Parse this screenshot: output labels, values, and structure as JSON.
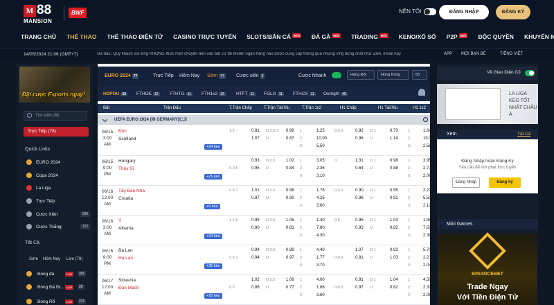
{
  "header": {
    "logo_icon": "M",
    "logo_num": "88",
    "logo_text": "MANSION",
    "partner": "BWF",
    "dark_mode": "NỀN TỐI",
    "login": "ĐĂNG NHẬP",
    "register": "ĐĂNG KÝ"
  },
  "nav": [
    {
      "label": "TRANG CHỦ"
    },
    {
      "label": "THỂ THAO",
      "active": true
    },
    {
      "label": "THỂ THAO ĐIỆN TỬ"
    },
    {
      "label": "CASINO TRỰC TUYẾN"
    },
    {
      "label": "SLOTS/BẮN CÁ",
      "hot": "MỚI"
    },
    {
      "label": "ĐÁ GÀ",
      "hot": "MỚI"
    },
    {
      "label": "TRADING",
      "hot": "MỚI"
    },
    {
      "label": "KENO/XỔ SỐ"
    },
    {
      "label": "P2P",
      "hot": "MỚI"
    },
    {
      "label": "ĐỘC QUYỀN"
    },
    {
      "label": "KHUYẾN MÃI"
    },
    {
      "label": "VIP"
    }
  ],
  "ticker": {
    "datetime": "14/05/2024 21:06 (GMT+7)",
    "message": "Ga đấu: Quý khách vui lòng KHÔNG thực hiện chuyển tiền vào bất cứ tài khoản ngân hàng nào được cung cấp thông qua những ứng dụng chat như Zalo, email hay",
    "app": "APP",
    "refer": "MỜI BẠN BÈ",
    "lang": "TIẾNG VIỆT"
  },
  "left": {
    "banner": "Đặt cược Esports ngay!",
    "search": "Tìm kiếm đội",
    "live": "Trực Tiếp (78)",
    "quick_links": "Quick Links",
    "links": [
      {
        "label": "EURO 2024",
        "icon": "trophy-icon"
      },
      {
        "label": "Copa 2024",
        "icon": "trophy-icon"
      },
      {
        "label": "La Liga",
        "icon": "ball-icon"
      },
      {
        "label": "Trực Tiếp",
        "icon": "live-icon"
      },
      {
        "label": "Cược Xiên",
        "count": "583",
        "icon": "parlay-icon"
      },
      {
        "label": "Cược Thắng",
        "count": "152",
        "icon": "win-icon"
      }
    ],
    "all": "Tất Cả",
    "tabs": [
      "Sớm",
      "Hôm Nay",
      "Live (78)"
    ],
    "sports": [
      {
        "label": "Bóng đá",
        "live": "Live",
        "count": "391"
      },
      {
        "label": "Bóng Đá Đi...",
        "live": "Live",
        "count": "29"
      },
      {
        "label": "Bóng Rổ",
        "live": "Live",
        "count": "221"
      }
    ]
  },
  "center": {
    "league_tab": "EURO 2024",
    "league_count": "77",
    "tabs": [
      {
        "label": "Trực Tiếp"
      },
      {
        "label": "Hôm Nay"
      },
      {
        "label": "Sớm",
        "count": "77",
        "active": true
      }
    ],
    "parlay": "Cược xiên",
    "parlay_count": "0",
    "quick": "Cược Nhanh",
    "sort": "Hàng Đội",
    "odds": "Hong Kong",
    "count55": "55",
    "markets": [
      {
        "label": "HDPOU",
        "count": "12",
        "active": true
      },
      {
        "label": "FTHOE",
        "count": "12"
      },
      {
        "label": "FTHTG",
        "count": "11"
      },
      {
        "label": "FTH1x2",
        "count": "12"
      },
      {
        "label": "HTFT",
        "count": "11"
      },
      {
        "label": "FGLG",
        "count": "11"
      },
      {
        "label": "FTHCS",
        "count": "11"
      },
      {
        "label": "Outright",
        "count": "45"
      }
    ],
    "columns": [
      "Bắt",
      "Trận Đấu",
      "T.Trận Chấp",
      "T.Trận Tài/Xỉu",
      "T.Trận 1x2",
      "H1 Chấp",
      "H1 Tài/Xỉu",
      "H1 1x2"
    ],
    "league": "UEFA EURO 2024 (IN GERMANY)",
    "league_matches": "12",
    "matches": [
      {
        "date": "06/15",
        "time": "3:00",
        "ampm": "AM",
        "home": "Đức",
        "away": "Scotland",
        "hl": "home",
        "more": "+24 kèo",
        "hdp": [
          "1.5",
          "",
          "0.81",
          "1.07"
        ],
        "ou": [
          "O 2.5-3",
          "U",
          "0.99",
          "0.87"
        ],
        "x12": [
          "1.25",
          "10.00",
          "5.50"
        ],
        "h1h": [
          "0.5-1",
          "",
          "0.92",
          "0.96"
        ],
        "h1ou": [
          "O 1",
          "U",
          "0.73",
          "1.14"
        ],
        "h1x": [
          "1.64",
          "10.00",
          "2.58"
        ]
      },
      {
        "date": "06/15",
        "time": "9:00",
        "ampm": "PM",
        "home": "Hungary",
        "away": "Thụy Sĩ",
        "hl": "away",
        "more": "+25 kèo",
        "hdp": [
          "",
          "0-0.5",
          "0.93",
          "0.95"
        ],
        "ou": [
          "O 2.5",
          "U",
          "1.02",
          "0.84"
        ],
        "x12": [
          "3.05",
          "2.36",
          "3.10"
        ],
        "h1h": [
          "0",
          "",
          "1.31",
          "0.64"
        ],
        "h1ou": [
          "O 1",
          "U",
          "0.98",
          "0.88"
        ],
        "h1x": [
          "3.95",
          "2.77",
          "2.06"
        ]
      },
      {
        "date": "06/16",
        "time": "12:00",
        "ampm": "AM",
        "home": "Tây Ban Nha",
        "away": "Croatia",
        "hl": "home",
        "more": "+6 kèo",
        "hdp": [
          "0.5-1",
          "",
          "1.01",
          "0.87"
        ],
        "ou": [
          "O 2.5",
          "U",
          "0.96",
          "0.90"
        ],
        "x12": [
          "1.76",
          "4.25",
          "3.60"
        ],
        "h1h": [
          "0-0.5",
          "",
          "0.90",
          "0.98"
        ],
        "h1ou": [
          "O 1",
          "U",
          "0.95",
          "0.91"
        ],
        "h1x": [
          "2.27",
          "5.50",
          "2.12"
        ]
      },
      {
        "date": "06/16",
        "time": "3:00",
        "ampm": "AM",
        "home": "Ý",
        "away": "Albania",
        "hl": "home",
        "more": "+24 kèo",
        "hdp": [
          "1-1.5",
          "",
          "0.98",
          "0.90"
        ],
        "ou": [
          "O 2.5",
          "U",
          "1.05",
          "0.81"
        ],
        "x12": [
          "1.40",
          "7.80",
          "4.30"
        ],
        "h1h": [
          "0.5",
          "",
          "0.95",
          "0.93"
        ],
        "h1ou": [
          "O 1",
          "U",
          "1.04",
          "0.82"
        ],
        "h1x": [
          "1.95",
          "7.50",
          "2.38"
        ]
      },
      {
        "date": "06/16",
        "time": "9:00",
        "ampm": "PM",
        "home": "Ba Lan",
        "away": "Hà Lan",
        "hl": "away",
        "more": "+25 kèo",
        "hdp": [
          "",
          "0.5-1",
          "0.94",
          "0.94"
        ],
        "ou": [
          "O 2.5",
          "U",
          "0.89",
          "0.97"
        ],
        "x12": [
          "4.40",
          "1.77",
          "3.70"
        ],
        "h1h": [
          "",
          "0-0.5",
          "1.07",
          "0.81"
        ],
        "h1ou": [
          "O 1",
          "U",
          "0.83",
          "1.03"
        ],
        "h1x": [
          "5.70",
          "2.21",
          "2.04"
        ]
      },
      {
        "date": "06/17",
        "time": "12:00",
        "ampm": "AM",
        "home": "Slovenia",
        "away": "Đan Mạch",
        "hl": "away",
        "more": "+25 kèo",
        "hdp": [
          "",
          "0.5",
          "1.02",
          "0.86"
        ],
        "ou": [
          "O 2.5",
          "U",
          "1.09",
          "0.77"
        ],
        "x12": [
          "4.00",
          "1.86",
          "3.60"
        ],
        "h1h": [
          "",
          "0-0.5",
          "0.91",
          "0.97"
        ],
        "h1ou": [
          "O 1",
          "U",
          "1.04",
          "0.82"
        ],
        "h1x": [
          "4.50",
          "2.37",
          "2.06"
        ]
      }
    ]
  },
  "right": {
    "interface": "Về Giao Diện Cũ",
    "banner_l1": "LA LIGA",
    "banner_l2": "KÈO TỐT",
    "banner_l3": "NHẤT CHÂU Á",
    "xem": "Xem",
    "xem_all": "Tất Cả",
    "login_title": "Đăng Nhập hoặc Đăng Ký",
    "login_sub": "Yêu cầu để mở phát trực tuyến",
    "btn_login": "Đăng Nhập",
    "btn_reg": "Đăng ký",
    "mini": "Mini Games",
    "brand": "BINANCEBET",
    "promo1": "Trade Ngay",
    "promo2": "Với Tiền Điện Tử"
  }
}
